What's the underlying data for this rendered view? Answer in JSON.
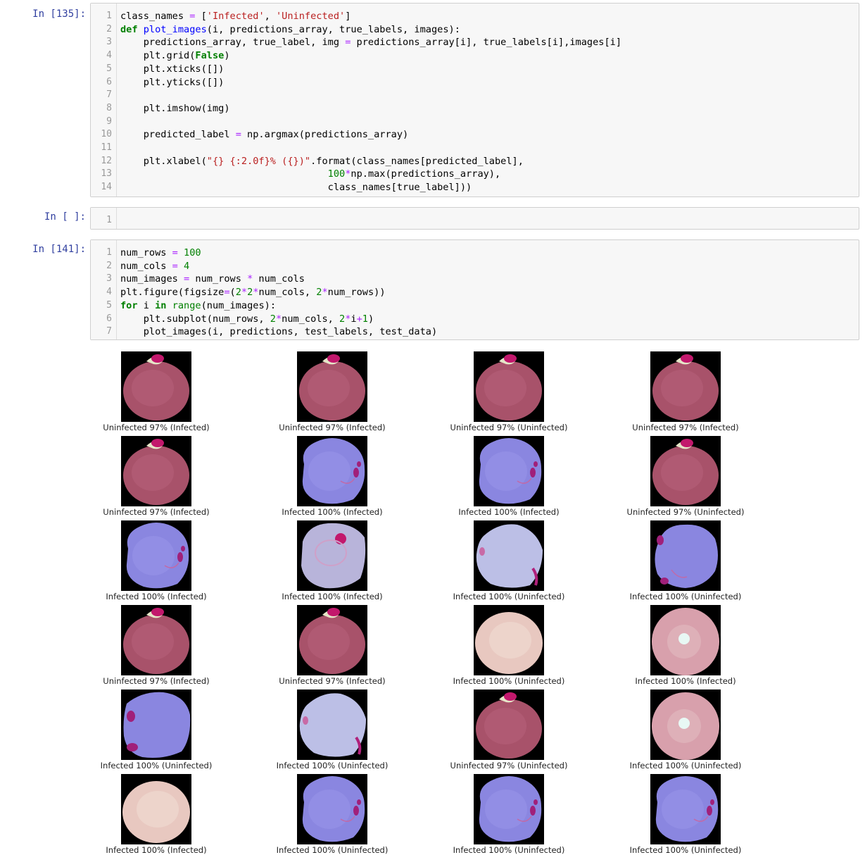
{
  "cells": [
    {
      "prompt": "In [135]:",
      "lines": [
        [
          [
            "class_names ",
            ""
          ],
          [
            "=",
            "op"
          ],
          [
            " [",
            ""
          ],
          [
            "'Infected'",
            "str"
          ],
          [
            ", ",
            ""
          ],
          [
            "'Uninfected'",
            "str"
          ],
          [
            "]",
            ""
          ]
        ],
        [
          [
            "def",
            "kw"
          ],
          [
            " ",
            ""
          ],
          [
            "plot_images",
            "fn"
          ],
          [
            "(i, predictions_array, true_labels, images):",
            ""
          ]
        ],
        [
          [
            "    predictions_array, true_label, img ",
            ""
          ],
          [
            "=",
            "op"
          ],
          [
            " predictions_array[i], true_labels[i],images[i]",
            ""
          ]
        ],
        [
          [
            "    plt.grid(",
            ""
          ],
          [
            "False",
            "kw"
          ],
          [
            ")",
            ""
          ]
        ],
        [
          [
            "    plt.xticks([])",
            ""
          ]
        ],
        [
          [
            "    plt.yticks([])",
            ""
          ]
        ],
        [
          [
            "",
            ""
          ]
        ],
        [
          [
            "    plt.imshow(img)",
            ""
          ]
        ],
        [
          [
            "",
            ""
          ]
        ],
        [
          [
            "    predicted_label ",
            ""
          ],
          [
            "=",
            "op"
          ],
          [
            " np.argmax(predictions_array)",
            ""
          ]
        ],
        [
          [
            "",
            ""
          ]
        ],
        [
          [
            "    plt.xlabel(",
            ""
          ],
          [
            "\"{} {:2.0f}% ({})\"",
            "str"
          ],
          [
            ".format(class_names[predicted_label],",
            ""
          ]
        ],
        [
          [
            "                                    ",
            ""
          ],
          [
            "100",
            "num"
          ],
          [
            "*",
            "op"
          ],
          [
            "np.max(predictions_array),",
            ""
          ]
        ],
        [
          [
            "                                    class_names[true_label]))",
            ""
          ]
        ]
      ]
    },
    {
      "prompt": "In [ ]:",
      "lines": [
        [
          [
            "",
            ""
          ]
        ]
      ]
    },
    {
      "prompt": "In [141]:",
      "lines": [
        [
          [
            "num_rows ",
            ""
          ],
          [
            "=",
            "op"
          ],
          [
            " ",
            ""
          ],
          [
            "100",
            "num"
          ]
        ],
        [
          [
            "num_cols ",
            ""
          ],
          [
            "=",
            "op"
          ],
          [
            " ",
            ""
          ],
          [
            "4",
            "num"
          ]
        ],
        [
          [
            "num_images ",
            ""
          ],
          [
            "=",
            "op"
          ],
          [
            " num_rows ",
            ""
          ],
          [
            "*",
            "op"
          ],
          [
            " num_cols",
            ""
          ]
        ],
        [
          [
            "plt.figure(figsize",
            ""
          ],
          [
            "=",
            "op"
          ],
          [
            "(",
            ""
          ],
          [
            "2",
            "num"
          ],
          [
            "*",
            "op"
          ],
          [
            "2",
            "num"
          ],
          [
            "*",
            "op"
          ],
          [
            "num_cols, ",
            ""
          ],
          [
            "2",
            "num"
          ],
          [
            "*",
            "op"
          ],
          [
            "num_rows))",
            ""
          ]
        ],
        [
          [
            "for",
            "kw"
          ],
          [
            " i ",
            ""
          ],
          [
            "in",
            "kw"
          ],
          [
            " ",
            ""
          ],
          [
            "range",
            "bi"
          ],
          [
            "(num_images):",
            ""
          ]
        ],
        [
          [
            "    plt.subplot(num_rows, ",
            ""
          ],
          [
            "2",
            "num"
          ],
          [
            "*",
            "op"
          ],
          [
            "num_cols, ",
            ""
          ],
          [
            "2",
            "num"
          ],
          [
            "*",
            "op"
          ],
          [
            "i",
            ""
          ],
          [
            "+",
            "op"
          ],
          [
            "1",
            "num"
          ],
          [
            ")",
            ""
          ]
        ],
        [
          [
            "    plot_images(i, predictions, test_labels, test_data)",
            ""
          ]
        ]
      ]
    }
  ],
  "output": {
    "captions": [
      [
        "Uninfected 97% (Infected)",
        "Uninfected 97% (Infected)",
        "Uninfected 97% (Uninfected)",
        "Uninfected 97% (Infected)"
      ],
      [
        "Uninfected 97% (Infected)",
        "Infected 100% (Infected)",
        "Infected 100% (Infected)",
        "Uninfected 97% (Uninfected)"
      ],
      [
        "Infected 100% (Infected)",
        "Infected 100% (Infected)",
        "Infected 100% (Uninfected)",
        "Infected 100% (Uninfected)"
      ],
      [
        "Uninfected 97% (Infected)",
        "Uninfected 97% (Infected)",
        "Infected 100% (Uninfected)",
        "Infected 100% (Infected)"
      ],
      [
        "Infected 100% (Uninfected)",
        "Infected 100% (Uninfected)",
        "Uninfected 97% (Uninfected)",
        "Infected 100% (Uninfected)"
      ],
      [
        "Infected 100% (Infected)",
        "Infected 100% (Uninfected)",
        "Infected 100% (Uninfected)",
        "Infected 100% (Uninfected)"
      ]
    ],
    "cells_kind": [
      [
        "red",
        "red",
        "red",
        "red"
      ],
      [
        "red",
        "blue",
        "blue",
        "red"
      ],
      [
        "blue",
        "pale",
        "paleblue",
        "blue2"
      ],
      [
        "red",
        "red",
        "beige",
        "pink"
      ],
      [
        "blue3",
        "paleblue",
        "red",
        "pink"
      ],
      [
        "beige",
        "blue",
        "blue",
        "blue"
      ]
    ]
  },
  "colors": {
    "prompt": "#303f9f",
    "red_cell": "#a8526a",
    "blue_cell": "#8a86e0",
    "pale_cell": "#b8b4da",
    "beige_cell": "#e8c8c0",
    "pink_cell": "#d8a0ac"
  }
}
